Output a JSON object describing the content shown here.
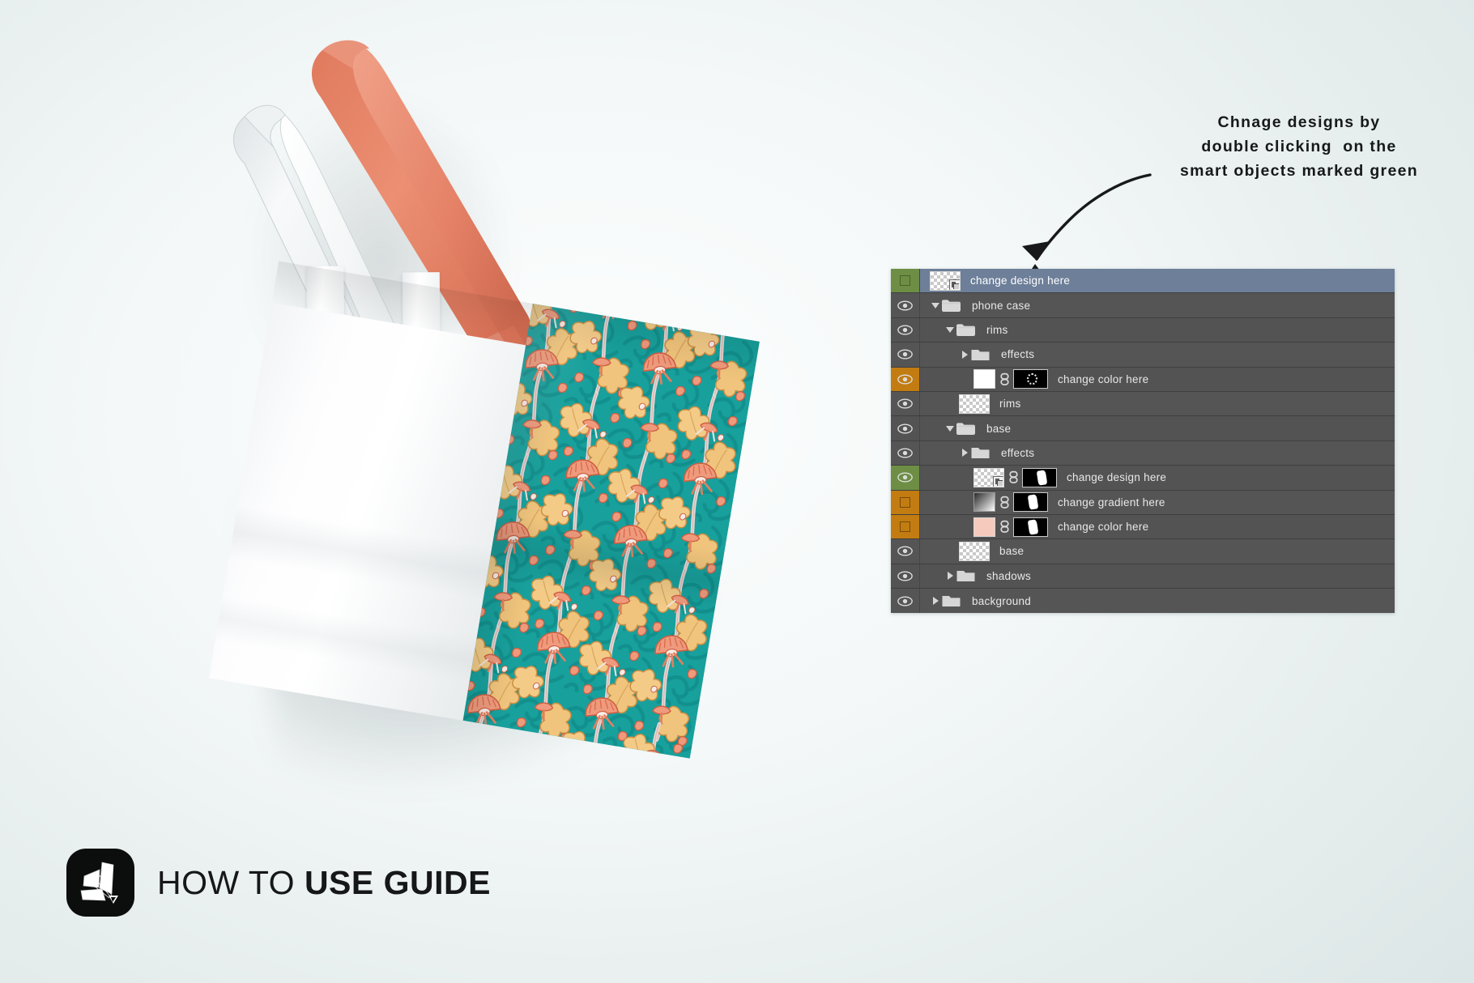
{
  "annotation": {
    "line1": "Chnage designs by",
    "line2": "double clicking  on the",
    "line3": "smart objects marked green",
    "arrow_icon": "curved-arrow-icon"
  },
  "footer": {
    "text_light": "HOW TO ",
    "text_bold": "USE GUIDE",
    "logo_icon": "origami-logo-icon"
  },
  "mockup": {
    "product": "tote bag",
    "handle_colors": [
      "#ffffff",
      "#e58267"
    ],
    "panel_white": "#ffffff",
    "pattern_base": "#18a09c",
    "pattern_leaf": "#f3cb87",
    "pattern_flower": "#e8795c",
    "pattern_stem": "#e7d2cf"
  },
  "layers_panel": {
    "accent_green": "#6d8e44",
    "accent_orange": "#c27c11",
    "selection_blue": "#6d7f99",
    "panel_bg": "#535353",
    "rows": [
      {
        "name": "change design here",
        "swatch": "green",
        "visible": false,
        "selected": true,
        "indent": 1,
        "kind": "smart-object",
        "thumb": "checker",
        "has_chain": false,
        "has_mask": false
      },
      {
        "name": "phone case",
        "swatch": "none",
        "visible": true,
        "selected": false,
        "indent": 1,
        "kind": "group",
        "expanded": true
      },
      {
        "name": "rims",
        "swatch": "none",
        "visible": true,
        "selected": false,
        "indent": 2,
        "kind": "group",
        "expanded": true
      },
      {
        "name": "effects",
        "swatch": "none",
        "visible": true,
        "selected": false,
        "indent": 3,
        "kind": "group",
        "expanded": false
      },
      {
        "name": "change color here",
        "swatch": "orange",
        "visible": true,
        "selected": false,
        "indent": 4,
        "kind": "fill-layer",
        "thumb": "solid-white",
        "has_chain": true,
        "has_mask": true,
        "mask_style": "ring"
      },
      {
        "name": "rims",
        "swatch": "none",
        "visible": true,
        "selected": false,
        "indent": 3,
        "kind": "raster",
        "thumb": "checker",
        "has_chain": false,
        "has_mask": false
      },
      {
        "name": "base",
        "swatch": "none",
        "visible": true,
        "selected": false,
        "indent": 2,
        "kind": "group",
        "expanded": true
      },
      {
        "name": "effects",
        "swatch": "none",
        "visible": true,
        "selected": false,
        "indent": 3,
        "kind": "group",
        "expanded": false
      },
      {
        "name": "change design here",
        "swatch": "green",
        "visible": true,
        "selected": false,
        "indent": 4,
        "kind": "smart-object",
        "thumb": "checker",
        "has_chain": true,
        "has_mask": true,
        "mask_style": "bag"
      },
      {
        "name": "change gradient here",
        "swatch": "orange",
        "visible": false,
        "selected": false,
        "indent": 4,
        "kind": "gradient-fill",
        "thumb": "grad",
        "has_chain": true,
        "has_mask": true,
        "mask_style": "bag"
      },
      {
        "name": "change color here",
        "swatch": "orange",
        "visible": false,
        "selected": false,
        "indent": 4,
        "kind": "solid-fill",
        "thumb": "pink",
        "has_chain": true,
        "has_mask": true,
        "mask_style": "bag"
      },
      {
        "name": "base",
        "swatch": "none",
        "visible": true,
        "selected": false,
        "indent": 3,
        "kind": "raster",
        "thumb": "checker",
        "has_chain": false,
        "has_mask": false
      },
      {
        "name": "shadows",
        "swatch": "none",
        "visible": true,
        "selected": false,
        "indent": 2,
        "kind": "group",
        "expanded": false
      },
      {
        "name": "background",
        "swatch": "none",
        "visible": true,
        "selected": false,
        "indent": 1,
        "kind": "group",
        "expanded": false
      }
    ]
  }
}
